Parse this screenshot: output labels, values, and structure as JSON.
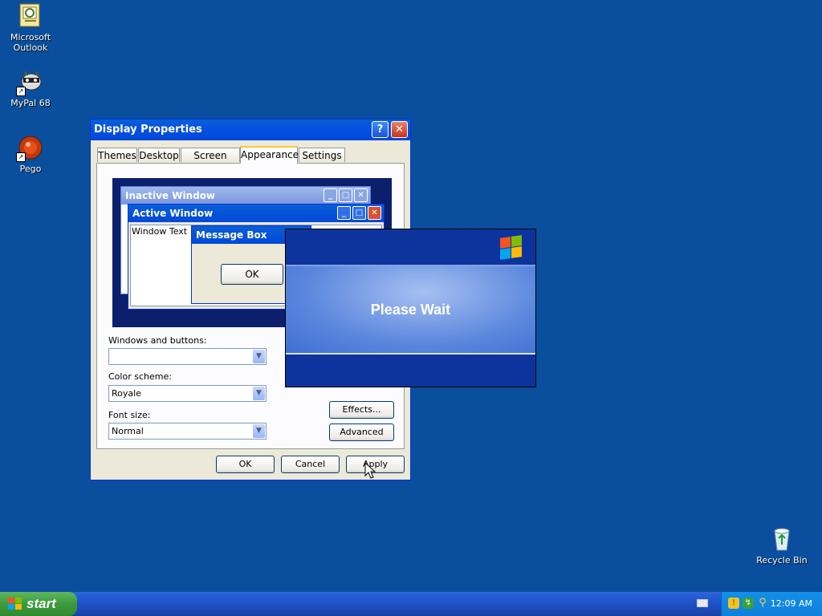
{
  "desktop": {
    "icons": [
      {
        "label": "Microsoft Outlook"
      },
      {
        "label": "MyPal 68"
      },
      {
        "label": "Pego"
      },
      {
        "label": "Recycle Bin"
      }
    ]
  },
  "dialog": {
    "title": "Display Properties",
    "help_glyph": "?",
    "close_glyph": "✕",
    "tabs": [
      "Themes",
      "Desktop",
      "Screen Saver",
      "Appearance",
      "Settings"
    ],
    "selected_tab": "Appearance",
    "preview": {
      "inactive_title": "Inactive Window",
      "active_title": "Active Window",
      "window_text": "Window Text",
      "message_title": "Message Box",
      "ok": "OK"
    },
    "windows_and_buttons_label": "Windows and buttons:",
    "windows_and_buttons_value": "",
    "color_scheme_label": "Color scheme:",
    "color_scheme_value": "Royale",
    "font_size_label": "Font size:",
    "font_size_value": "Normal",
    "effects_button": "Effects...",
    "advanced_button": "Advanced",
    "ok_button": "OK",
    "cancel_button": "Cancel",
    "apply_button": "Apply"
  },
  "wait_dialog": {
    "message": "Please Wait"
  },
  "taskbar": {
    "start_label": "start",
    "clock": "12:09 AM"
  },
  "colors": {
    "desktop": "#0a4f9e",
    "title_bar": "#0054e3",
    "start_button": "#3c9a3c",
    "tray": "#0f7fdc"
  }
}
